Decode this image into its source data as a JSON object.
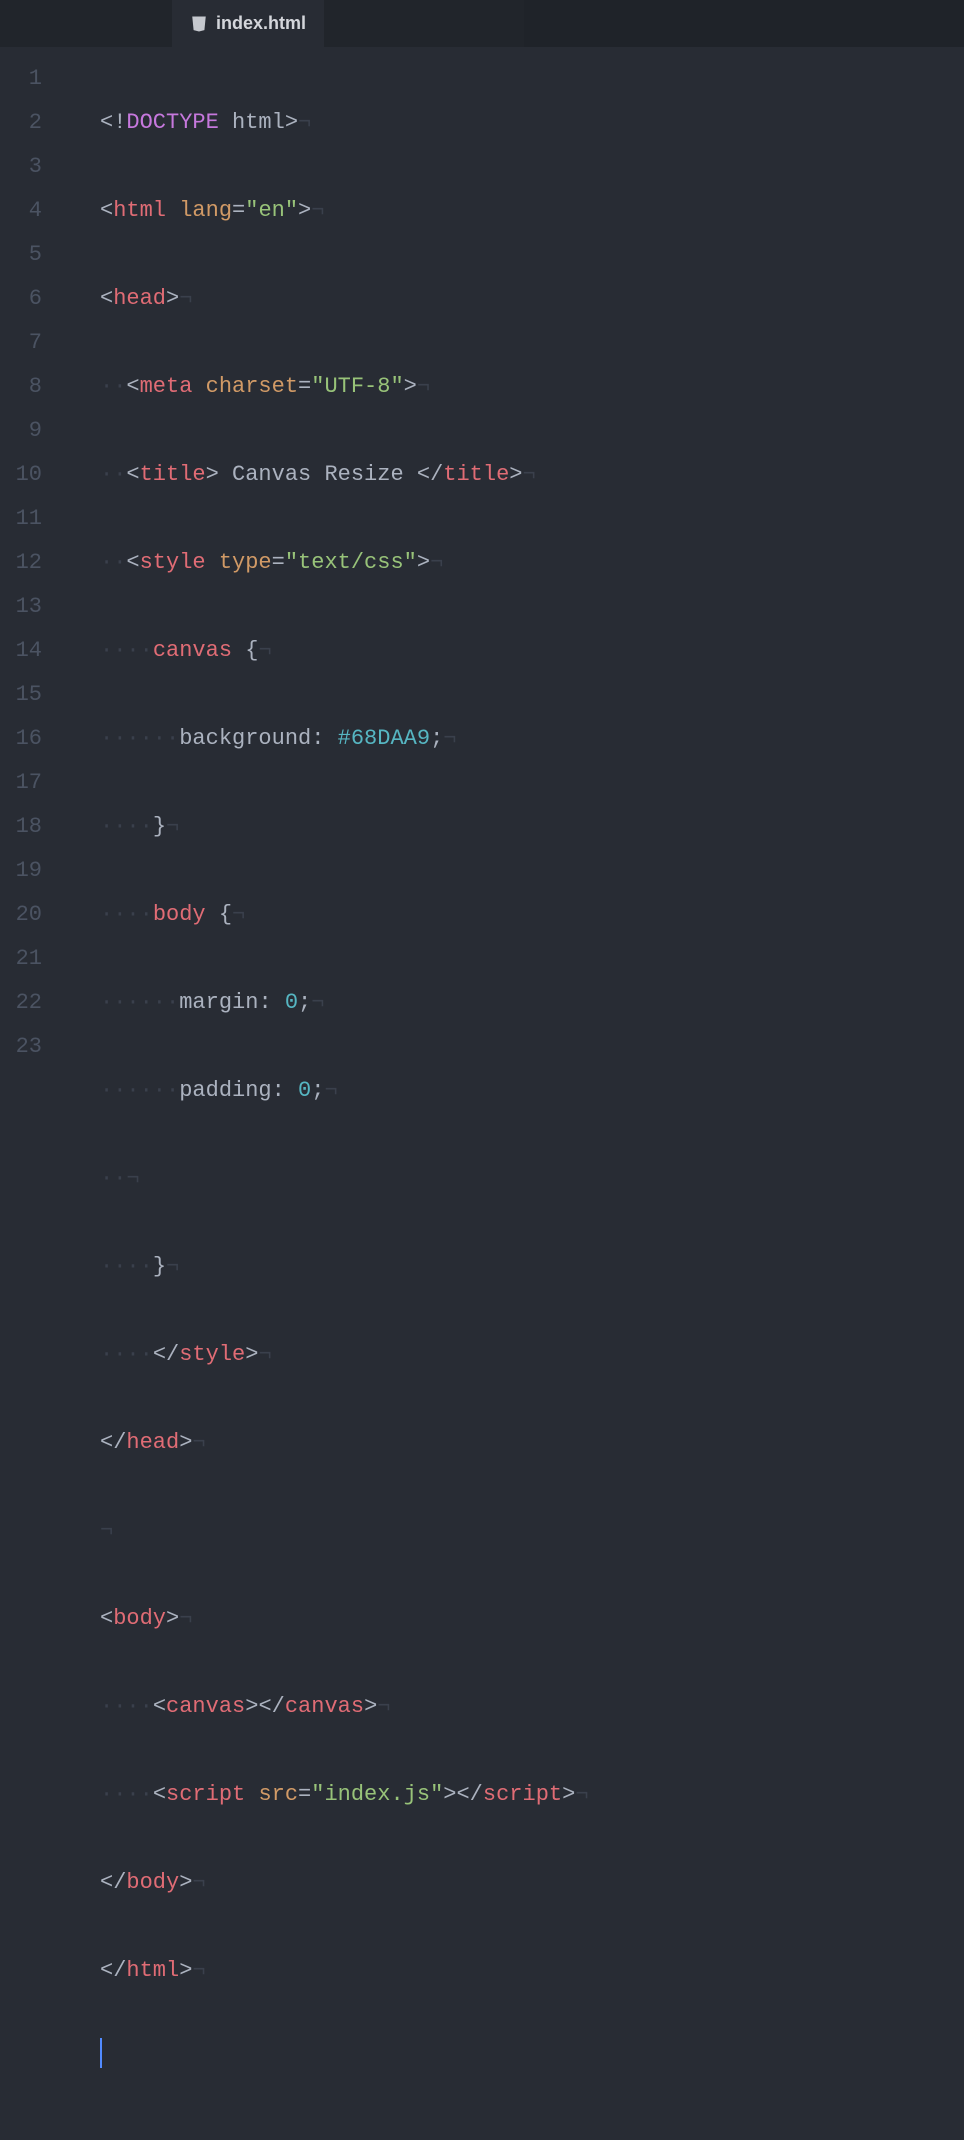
{
  "tab": {
    "filename": "index.html"
  },
  "lines": [
    "1",
    "2",
    "3",
    "4",
    "5",
    "6",
    "7",
    "8",
    "9",
    "10",
    "11",
    "12",
    "13",
    "14",
    "15",
    "16",
    "17",
    "18",
    "19",
    "20",
    "21",
    "22",
    "23"
  ],
  "code": {
    "l1": {
      "a": "<!",
      "b": "DOCTYPE",
      "c": " html",
      "d": ">",
      "ws": "¬"
    },
    "l2": {
      "a": "<",
      "tag": "html",
      "sp": " ",
      "attr": "lang",
      "eq": "=",
      "q1": "\"",
      "val": "en",
      "q2": "\"",
      "b": ">",
      "ws": "¬"
    },
    "l3": {
      "a": "<",
      "tag": "head",
      "b": ">",
      "ws": "¬"
    },
    "l4": {
      "ind": "··",
      "a": "<",
      "tag": "meta",
      "sp": " ",
      "attr": "charset",
      "eq": "=",
      "q1": "\"",
      "val": "UTF-8",
      "q2": "\"",
      "b": ">",
      "ws": "¬"
    },
    "l5": {
      "ind": "··",
      "a": "<",
      "tag": "title",
      "b": ">",
      "txt": " Canvas Resize ",
      "c": "</",
      "tag2": "title",
      "d": ">",
      "ws": "¬"
    },
    "l6": {
      "ind": "··",
      "a": "<",
      "tag": "style",
      "sp": " ",
      "attr": "type",
      "eq": "=",
      "q1": "\"",
      "val": "text/css",
      "q2": "\"",
      "b": ">",
      "ws": "¬"
    },
    "l7": {
      "ind": "····",
      "sel": "canvas",
      "sp": " ",
      "brace": "{",
      "ws": "¬"
    },
    "l8": {
      "ind": "······",
      "prop": "background",
      "colon": ":",
      "sp": " ",
      "val": "#68DAA9",
      "semi": ";",
      "ws": "¬"
    },
    "l9": {
      "ind": "····",
      "brace": "}",
      "ws": "¬"
    },
    "l10": {
      "ind": "····",
      "sel": "body",
      "sp": " ",
      "brace": "{",
      "ws": "¬"
    },
    "l11": {
      "ind": "······",
      "prop": "margin",
      "colon": ":",
      "sp": " ",
      "val": "0",
      "semi": ";",
      "ws": "¬"
    },
    "l12": {
      "ind": "······",
      "prop": "padding",
      "colon": ":",
      "sp": " ",
      "val": "0",
      "semi": ";",
      "ws": "¬"
    },
    "l13": {
      "ind": "··",
      "ws": "¬"
    },
    "l14": {
      "ind": "····",
      "brace": "}",
      "ws": "¬"
    },
    "l15": {
      "ind": "····",
      "a": "</",
      "tag": "style",
      "b": ">",
      "ws": "¬"
    },
    "l16": {
      "a": "</",
      "tag": "head",
      "b": ">",
      "ws": "¬"
    },
    "l17": {
      "ws": "¬"
    },
    "l18": {
      "a": "<",
      "tag": "body",
      "b": ">",
      "ws": "¬"
    },
    "l19": {
      "ind": "····",
      "a": "<",
      "tag": "canvas",
      "b": ">",
      "c": "</",
      "tag2": "canvas",
      "d": ">",
      "ws": "¬"
    },
    "l20": {
      "ind": "····",
      "a": "<",
      "tag": "script",
      "sp": " ",
      "attr": "src",
      "eq": "=",
      "q1": "\"",
      "val": "index.js",
      "q2": "\"",
      "b": ">",
      "c": "</",
      "tag2": "script",
      "d": ">",
      "ws": "¬"
    },
    "l21": {
      "a": "</",
      "tag": "body",
      "b": ">",
      "ws": "¬"
    },
    "l22": {
      "a": "</",
      "tag": "html",
      "b": ">",
      "ws": "¬"
    }
  }
}
